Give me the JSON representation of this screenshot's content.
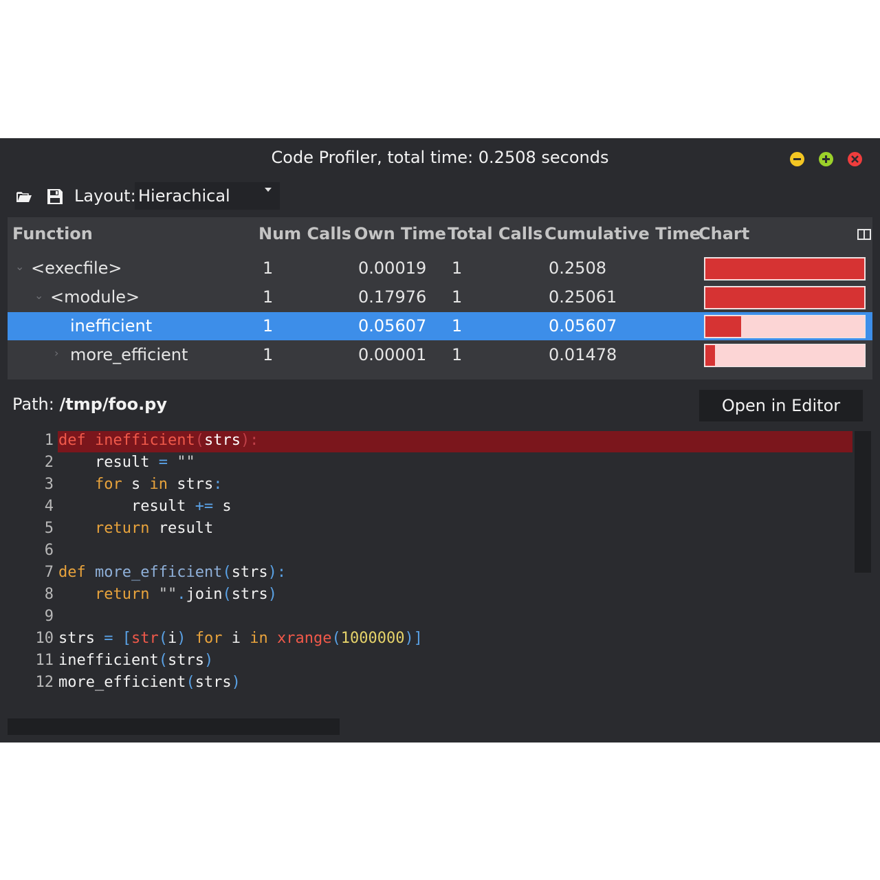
{
  "window": {
    "title": "Code Profiler, total time: 0.2508 seconds",
    "controls": [
      "minimize",
      "maximize",
      "close"
    ]
  },
  "toolbar": {
    "open_icon": "folder-open-icon",
    "save_icon": "save-icon",
    "layout_label": "Layout:",
    "layout_value": "Hierachical"
  },
  "table": {
    "headers": {
      "function": "Function",
      "num_calls": "Num Calls",
      "own_time": "Own Time",
      "total_calls": "Total Calls",
      "cumulative_time": "Cumulative Time",
      "chart": "Chart"
    },
    "rows": [
      {
        "function": "<execfile>",
        "num_calls": "1",
        "own_time": "0.00019",
        "total_calls": "1",
        "cumulative_time": "0.2508",
        "fraction": 1.0,
        "selected": false
      },
      {
        "function": "<module>",
        "num_calls": "1",
        "own_time": "0.17976",
        "total_calls": "1",
        "cumulative_time": "0.25061",
        "fraction": 0.999,
        "selected": false
      },
      {
        "function": "inefficient",
        "num_calls": "1",
        "own_time": "0.05607",
        "total_calls": "1",
        "cumulative_time": "0.05607",
        "fraction": 0.224,
        "selected": true
      },
      {
        "function": "more_efficient",
        "num_calls": "1",
        "own_time": "0.00001",
        "total_calls": "1",
        "cumulative_time": "0.01478",
        "fraction": 0.059,
        "selected": false
      }
    ],
    "bar_color": "#d63333",
    "bar_bg_color": "#fcd5d5",
    "selection_color": "#3d8ee9"
  },
  "path": {
    "label": "Path:",
    "value": "/tmp/foo.py"
  },
  "open_editor_label": "Open in Editor",
  "code": {
    "highlighted_line": 1,
    "lines": [
      {
        "n": "1",
        "text": "def inefficient(strs):"
      },
      {
        "n": "2",
        "text": "    result = \"\""
      },
      {
        "n": "3",
        "text": "    for s in strs:"
      },
      {
        "n": "4",
        "text": "        result += s"
      },
      {
        "n": "5",
        "text": "    return result"
      },
      {
        "n": "6",
        "text": ""
      },
      {
        "n": "7",
        "text": "def more_efficient(strs):"
      },
      {
        "n": "8",
        "text": "    return \"\".join(strs)"
      },
      {
        "n": "9",
        "text": ""
      },
      {
        "n": "10",
        "text": "strs = [str(i) for i in xrange(1000000)]"
      },
      {
        "n": "11",
        "text": "inefficient(strs)"
      },
      {
        "n": "12",
        "text": "more_efficient(strs)"
      }
    ]
  }
}
